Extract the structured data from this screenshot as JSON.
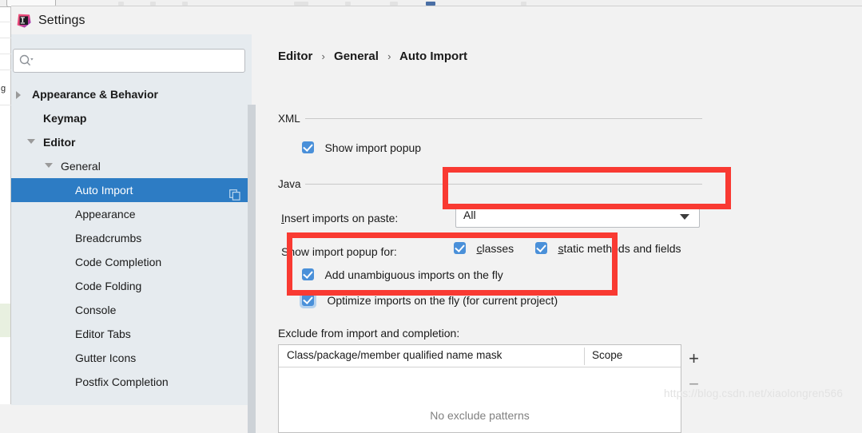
{
  "window": {
    "title": "Settings",
    "logo_icon": "intellij-idea-logo"
  },
  "search": {
    "value": "",
    "placeholder": "",
    "icon": "search-icon",
    "dropdown_icon": "chevron-down-icon"
  },
  "sidebar": {
    "items": [
      {
        "label": "Appearance & Behavior",
        "indent": 26,
        "arrow": "right",
        "bold": true,
        "selected": false
      },
      {
        "label": "Keymap",
        "indent": 40,
        "arrow": "none",
        "bold": true,
        "selected": false
      },
      {
        "label": "Editor",
        "indent": 40,
        "arrow": "down",
        "bold": true,
        "selected": false
      },
      {
        "label": "General",
        "indent": 62,
        "arrow": "down",
        "bold": false,
        "selected": false
      },
      {
        "label": "Auto Import",
        "indent": 80,
        "arrow": "none",
        "bold": false,
        "selected": true
      },
      {
        "label": "Appearance",
        "indent": 80,
        "arrow": "none",
        "bold": false,
        "selected": false
      },
      {
        "label": "Breadcrumbs",
        "indent": 80,
        "arrow": "none",
        "bold": false,
        "selected": false
      },
      {
        "label": "Code Completion",
        "indent": 80,
        "arrow": "none",
        "bold": false,
        "selected": false
      },
      {
        "label": "Code Folding",
        "indent": 80,
        "arrow": "none",
        "bold": false,
        "selected": false
      },
      {
        "label": "Console",
        "indent": 80,
        "arrow": "none",
        "bold": false,
        "selected": false
      },
      {
        "label": "Editor Tabs",
        "indent": 80,
        "arrow": "none",
        "bold": false,
        "selected": false
      },
      {
        "label": "Gutter Icons",
        "indent": 80,
        "arrow": "none",
        "bold": false,
        "selected": false
      },
      {
        "label": "Postfix Completion",
        "indent": 80,
        "arrow": "none",
        "bold": false,
        "selected": false
      }
    ],
    "selected_row_icon": "copy-settings-icon",
    "selected_color": "#2d7cc4"
  },
  "breadcrumb": {
    "parts": [
      "Editor",
      "General",
      "Auto Import"
    ],
    "separator": "›"
  },
  "main": {
    "xml_section": {
      "title": "XML",
      "checkbox": {
        "label": "Show import popup",
        "checked": true,
        "focused": false
      }
    },
    "java_section": {
      "title": "Java",
      "insert_imports_label": "Insert imports on paste:",
      "insert_imports_mnemonic": "I",
      "combo": {
        "value": "All",
        "arrow_icon": "dropdown-arrow-icon"
      },
      "show_popup_for_label": "Show import popup for:",
      "inline_checkboxes": [
        {
          "label": "classes",
          "mnemonic": "c",
          "checked": true
        },
        {
          "label": "static methods and fields",
          "mnemonic": "s",
          "checked": true
        }
      ],
      "fly_checkboxes": [
        {
          "label": "Add unambiguous imports on the fly",
          "checked": true,
          "focused": false
        },
        {
          "label": "Optimize imports on the fly (for current project)",
          "checked": true,
          "focused": true
        }
      ]
    },
    "exclude_section": {
      "label": "Exclude from import and completion:",
      "columns": [
        "Class/package/member qualified name mask",
        "Scope"
      ],
      "rows": [],
      "empty_text": "No exclude patterns",
      "add_button": "+",
      "remove_button": "−"
    }
  },
  "annotations": {
    "highlight_color": "#f93a32",
    "boxes": [
      {
        "name": "combo-highlight",
        "label": "Insert imports on paste dropdown"
      },
      {
        "name": "onfly-highlight",
        "label": "On-the-fly import checkboxes"
      }
    ]
  },
  "watermark": {
    "text": "https://blog.csdn.net/xiaolongren566"
  }
}
